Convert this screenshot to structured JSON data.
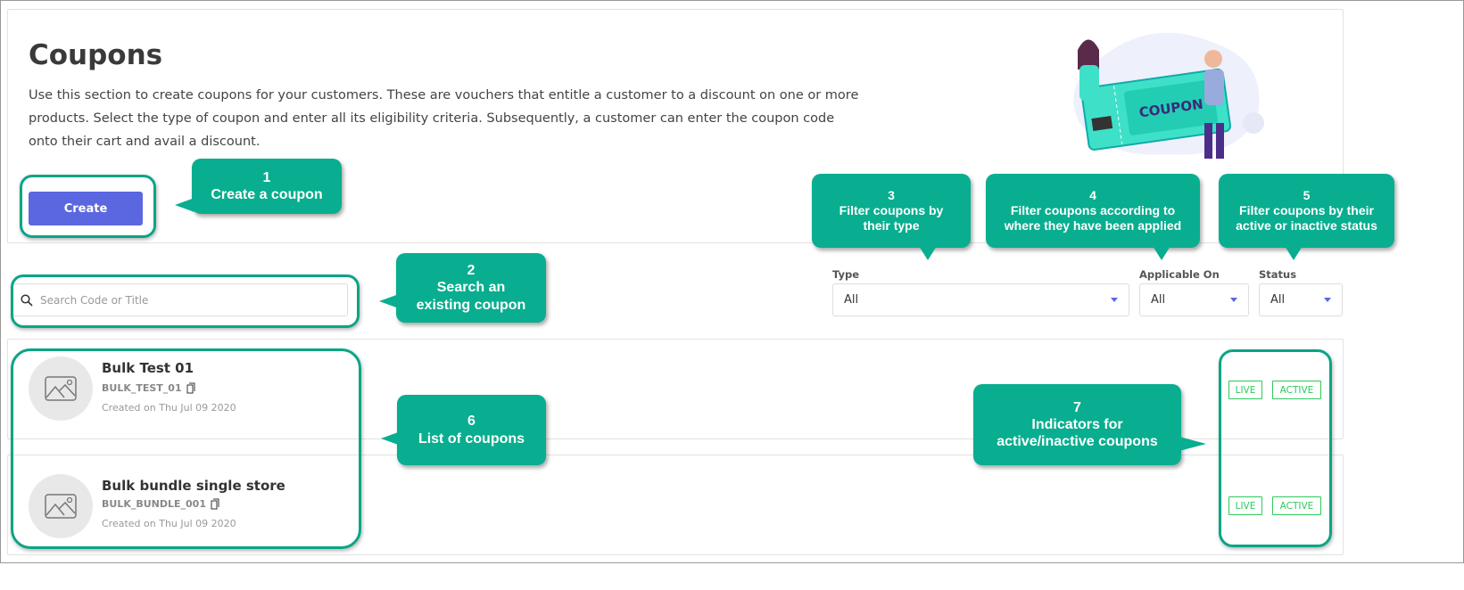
{
  "header": {
    "title": "Coupons",
    "description": "Use this section to create coupons for your customers. These are vouchers that entitle a customer to a discount on one or more products. Select the type of coupon and enter all its eligibility criteria. Subsequently, a customer can enter the coupon code onto their cart and avail a discount.",
    "create_label": "Create",
    "illustration_text": "COUPON"
  },
  "search": {
    "placeholder": "Search Code or Title",
    "icon": "search-icon"
  },
  "filters": [
    {
      "label": "Type",
      "value": "All"
    },
    {
      "label": "Applicable On",
      "value": "All"
    },
    {
      "label": "Status",
      "value": "All"
    }
  ],
  "coupons": [
    {
      "title": "Bulk Test 01",
      "code": "BULK_TEST_01",
      "created": "Created on Thu Jul 09 2020",
      "badges": [
        "LIVE",
        "ACTIVE"
      ]
    },
    {
      "title": "Bulk bundle single store",
      "code": "BULK_BUNDLE_001",
      "created": "Created on Thu Jul 09 2020",
      "badges": [
        "LIVE",
        "ACTIVE"
      ]
    }
  ],
  "callouts": [
    {
      "n": "1",
      "text": "Create a coupon"
    },
    {
      "n": "2",
      "text": "Search an existing coupon"
    },
    {
      "n": "3",
      "text": "Filter coupons by their type"
    },
    {
      "n": "4",
      "text": "Filter coupons according to where they have been applied"
    },
    {
      "n": "5",
      "text": "Filter coupons by their active or inactive status"
    },
    {
      "n": "6",
      "text": "List of coupons"
    },
    {
      "n": "7",
      "text": "Indicators for active/inactive coupons"
    }
  ],
  "colors": {
    "accent": "#5b67e0",
    "callout": "#08ae8f",
    "badge": "#2ec95c"
  }
}
